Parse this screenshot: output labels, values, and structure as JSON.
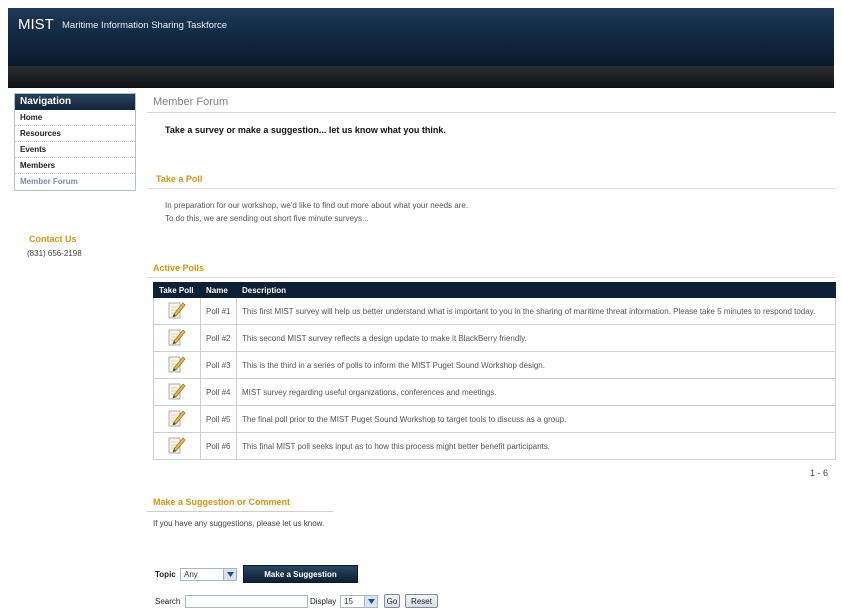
{
  "header": {
    "brand": "MIST",
    "tagline": "Maritime Information Sharing Taskforce"
  },
  "nav": {
    "title": "Navigation",
    "items": [
      {
        "label": "Home"
      },
      {
        "label": "Resources"
      },
      {
        "label": "Events"
      },
      {
        "label": "Members"
      },
      {
        "label": "Member Forum"
      }
    ]
  },
  "contact": {
    "title": "Contact Us",
    "phone": "(831) 656-2198"
  },
  "page": {
    "title": "Member Forum",
    "intro": "Take a survey or make a suggestion... let us know what you think."
  },
  "take_poll": {
    "title": "Take a Poll",
    "line1": "In preparation for our workshop, we'd like to find out more about what your needs are.",
    "line2": "To do this, we are sending out short five minute surveys..."
  },
  "active_polls": {
    "title": "Active Polls",
    "columns": [
      "Take Poll",
      "Name",
      "Description"
    ],
    "rows": [
      {
        "name": "Poll #1",
        "description": "This first MIST survey will help us better understand what is important to you in the sharing of maritime threat information. Please take 5 minutes to respond today."
      },
      {
        "name": "Poll #2",
        "description": "This second MIST survey reflects a design update to make it BlackBerry friendly."
      },
      {
        "name": "Poll #3",
        "description": "This is the third in a series of polls to inform the MIST Puget Sound Workshop design."
      },
      {
        "name": "Poll #4",
        "description": "MIST survey regarding useful organizations, conferences and meetings."
      },
      {
        "name": "Poll #5",
        "description": "The final poll prior to the MIST Puget Sound Workshop to target tools to discuss as a group."
      },
      {
        "name": "Poll #6",
        "description": "This final MIST poll seeks input as to how this process might better benefit participants."
      }
    ],
    "pager": "1 - 6"
  },
  "suggestion": {
    "title": "Make a Suggestion or Comment",
    "text": "If you have any suggestions, please let us know.",
    "topic_label": "Topic",
    "topic_value": "Any",
    "button_label": "Make a Suggestion",
    "search_label": "Search",
    "search_value": "",
    "display_label": "Display",
    "display_value": "15",
    "go_label": "Go",
    "reset_label": "Reset"
  },
  "colors": {
    "accent": "#d7931a",
    "header_dark": "#0d2035"
  }
}
